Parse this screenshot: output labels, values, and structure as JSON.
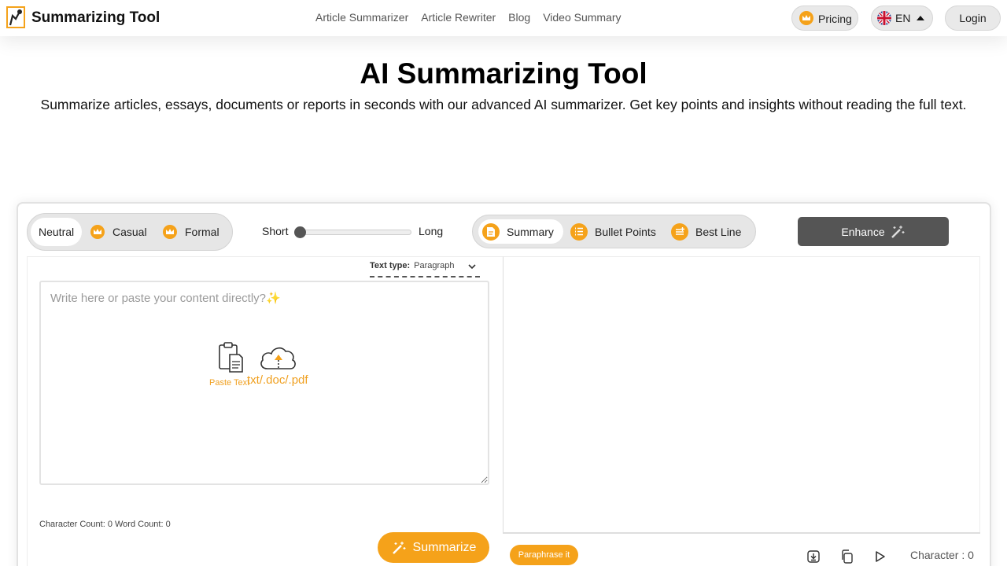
{
  "header": {
    "brand": "Summarizing Tool",
    "nav": [
      "Article Summarizer",
      "Article Rewriter",
      "Blog",
      "Video Summary"
    ],
    "pricing_label": "Pricing",
    "lang_label": "EN",
    "login_label": "Login"
  },
  "hero": {
    "title": "AI Summarizing Tool",
    "subtitle": "Summarize articles, essays, documents or reports in seconds with our advanced AI summarizer. Get key points and insights without reading the full text."
  },
  "modes": {
    "items": [
      "Neutral",
      "Casual",
      "Formal"
    ],
    "selected": "Neutral"
  },
  "length": {
    "short_label": "Short",
    "long_label": "Long",
    "value": 0
  },
  "output_types": {
    "items": [
      "Summary",
      "Bullet Points",
      "Best Line"
    ],
    "selected": "Summary"
  },
  "enhance_label": "Enhance",
  "input": {
    "text_type_label": "Text type:",
    "text_type_value": "Paragraph",
    "placeholder": "Write here or paste your content directly?✨",
    "paste_label": "Paste Text",
    "upload_label": "txt/.doc/.pdf",
    "counts": "Character Count: 0 Word Count: 0",
    "summarize_label": "Summarize"
  },
  "output": {
    "paraphrase_label": "Paraphrase it",
    "character_label": "Character : 0"
  },
  "colors": {
    "accent": "#f5a21a",
    "dark_button": "#555555"
  }
}
